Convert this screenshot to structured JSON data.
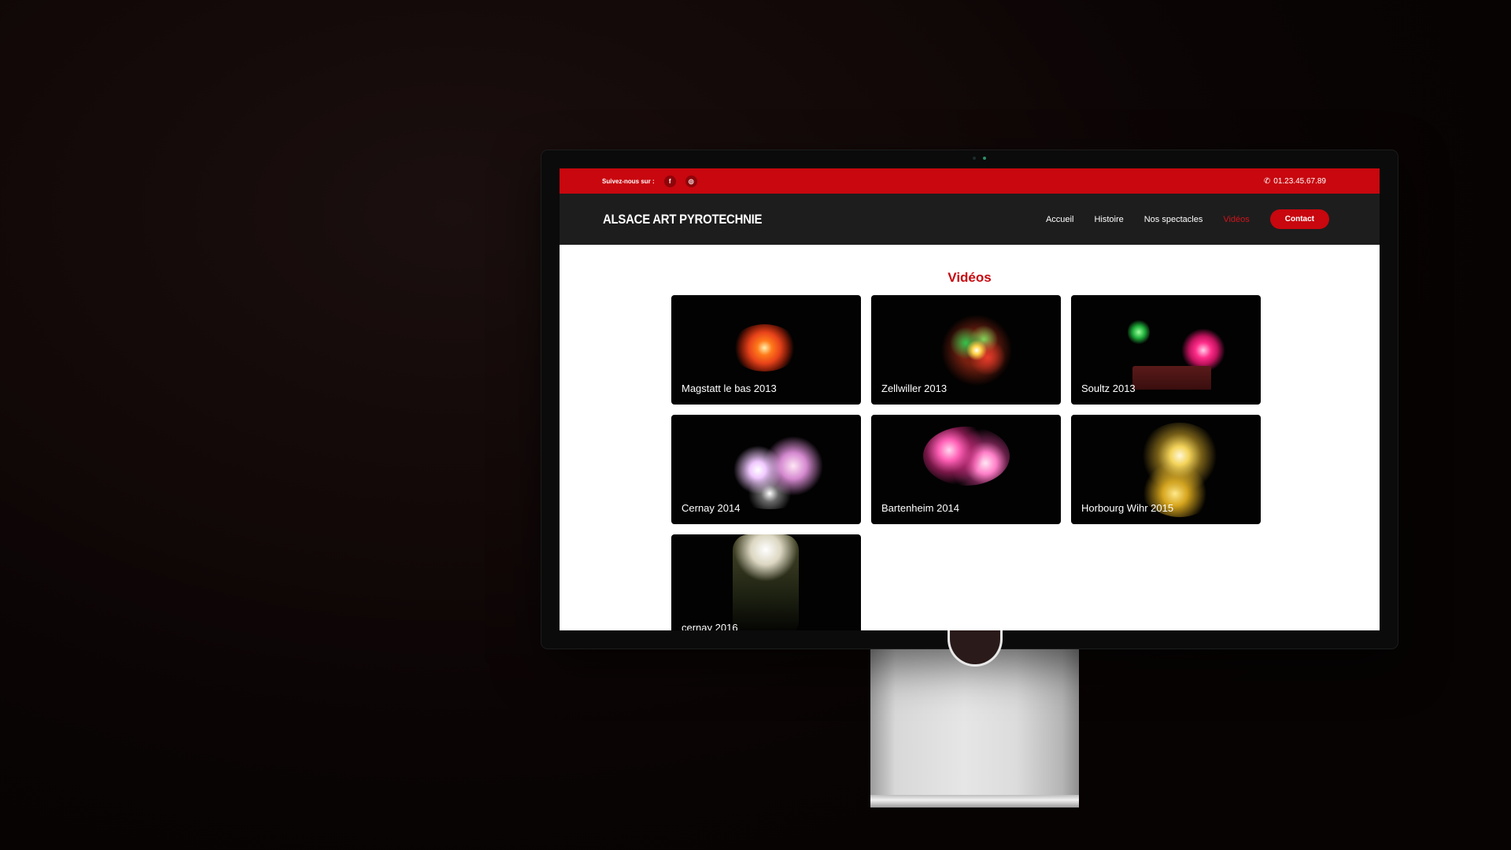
{
  "topbar": {
    "follow_label": "Suivez-nous sur :",
    "phone": "01.23.45.67.89",
    "social": [
      {
        "icon": "facebook-icon",
        "glyph": "f"
      },
      {
        "icon": "instagram-icon",
        "glyph": "◎"
      }
    ]
  },
  "nav": {
    "logo": "ALSACE ART PYROTECHNIE",
    "items": [
      {
        "label": "Accueil",
        "active": false
      },
      {
        "label": "Histoire",
        "active": false
      },
      {
        "label": "Nos spectacles",
        "active": false
      },
      {
        "label": "Vidéos",
        "active": true
      }
    ],
    "contact_label": "Contact"
  },
  "main": {
    "title": "Vidéos",
    "videos": [
      {
        "title": "Magstatt le bas 2013"
      },
      {
        "title": "Zellwiller 2013"
      },
      {
        "title": "Soultz 2013"
      },
      {
        "title": "Cernay 2014"
      },
      {
        "title": "Bartenheim 2014"
      },
      {
        "title": "Horbourg Wihr 2015"
      },
      {
        "title": "cernay 2016"
      }
    ]
  },
  "colors": {
    "brand_red": "#c8070e",
    "nav_bg": "#1d1d1d",
    "active_link": "#d1141b"
  }
}
